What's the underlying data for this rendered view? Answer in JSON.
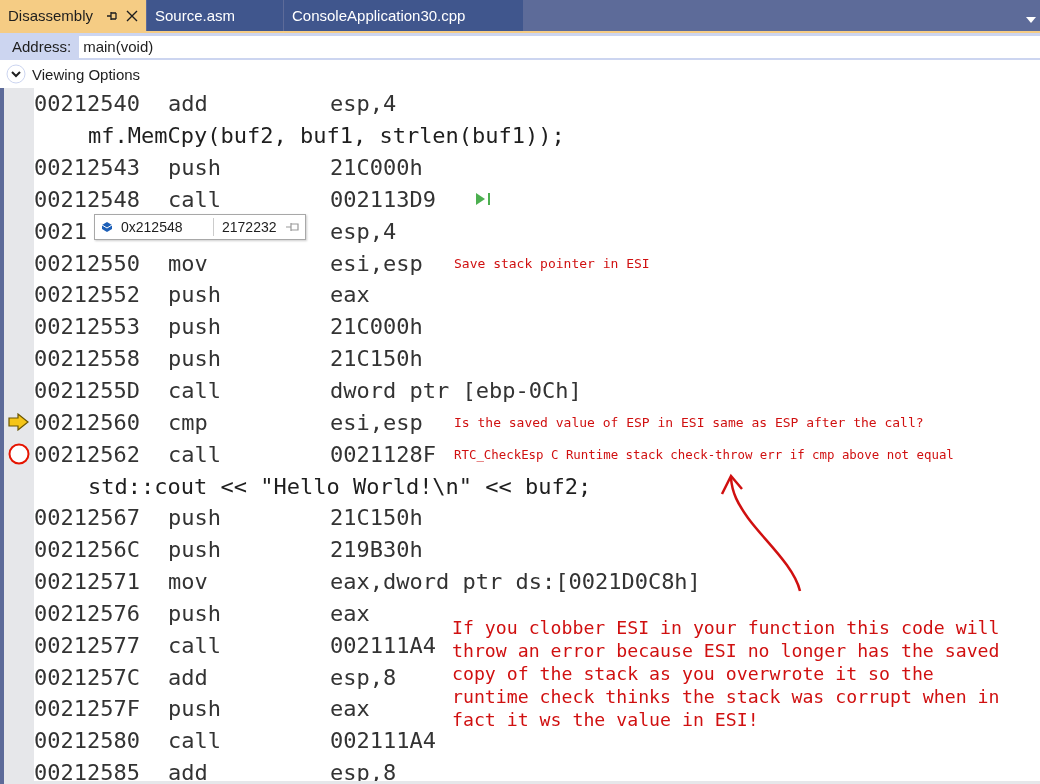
{
  "tabs": [
    {
      "label": "Disassembly",
      "selected": true
    },
    {
      "label": "Source.asm",
      "selected": false
    },
    {
      "label": "ConsoleApplication30.cpp",
      "selected": false
    }
  ],
  "address": {
    "label": "Address:",
    "value": "main(void)"
  },
  "viewing_options": {
    "label": "Viewing Options",
    "expanded": false
  },
  "rows": [
    {
      "kind": "instruction",
      "address": "00212540",
      "mnemonic": "add",
      "operands": "esp,4"
    },
    {
      "kind": "source",
      "text": "mf.MemCpy(buf2, buf1, strlen(buf1));"
    },
    {
      "kind": "instruction",
      "address": "00212543",
      "mnemonic": "push",
      "operands": "21C000h"
    },
    {
      "kind": "instruction",
      "address": "00212548",
      "mnemonic": "call",
      "operands": "002113D9",
      "run_to_here": true
    },
    {
      "kind": "instruction",
      "address": "0021",
      "operands": "esp,4"
    },
    {
      "kind": "instruction",
      "address": "00212550",
      "mnemonic": "mov",
      "operands": "esi,esp",
      "comment": "Save stack pointer in ESI"
    },
    {
      "kind": "instruction",
      "address": "00212552",
      "mnemonic": "push",
      "operands": "eax"
    },
    {
      "kind": "instruction",
      "address": "00212553",
      "mnemonic": "push",
      "operands": "21C000h"
    },
    {
      "kind": "instruction",
      "address": "00212558",
      "mnemonic": "push",
      "operands": "21C150h"
    },
    {
      "kind": "instruction",
      "address": "0021255D",
      "mnemonic": "call",
      "operands": "dword ptr [ebp-0Ch]"
    },
    {
      "kind": "instruction",
      "address": "00212560",
      "mnemonic": "cmp",
      "operands": "esi,esp",
      "comment": "Is the saved value of ESP in ESI same as ESP after the call?",
      "current_line": true
    },
    {
      "kind": "instruction",
      "address": "00212562",
      "mnemonic": "call",
      "operands": "0021128F",
      "comment": "RTC_CheckEsp C Runtime stack check-throw err if cmp above not equal",
      "breakpoint": true
    },
    {
      "kind": "source",
      "text": "std::cout << \"Hello World!\\n\" << buf2;"
    },
    {
      "kind": "instruction",
      "address": "00212567",
      "mnemonic": "push",
      "operands": "21C150h"
    },
    {
      "kind": "instruction",
      "address": "0021256C",
      "mnemonic": "push",
      "operands": "219B30h"
    },
    {
      "kind": "instruction",
      "address": "00212571",
      "mnemonic": "mov",
      "operands": "eax,dword ptr ds:[0021D0C8h]"
    },
    {
      "kind": "instruction",
      "address": "00212576",
      "mnemonic": "push",
      "operands": "eax"
    },
    {
      "kind": "instruction",
      "address": "00212577",
      "mnemonic": "call",
      "operands": "002111A4"
    },
    {
      "kind": "instruction",
      "address": "0021257C",
      "mnemonic": "add",
      "operands": "esp,8"
    },
    {
      "kind": "instruction",
      "address": "0021257F",
      "mnemonic": "push",
      "operands": "eax"
    },
    {
      "kind": "instruction",
      "address": "00212580",
      "mnemonic": "call",
      "operands": "002111A4"
    },
    {
      "kind": "instruction",
      "address": "00212585",
      "mnemonic": "add",
      "operands": "esp,8"
    }
  ],
  "tooltip": {
    "address": "0x212548",
    "value": "2172232"
  },
  "note": "If you clobber ESI in your function this code will throw an error because ESI no longer has the saved copy of the stack as you overwrote it so the runtime check thinks the stack was corrupt when in fact it ws the value in ESI!"
}
